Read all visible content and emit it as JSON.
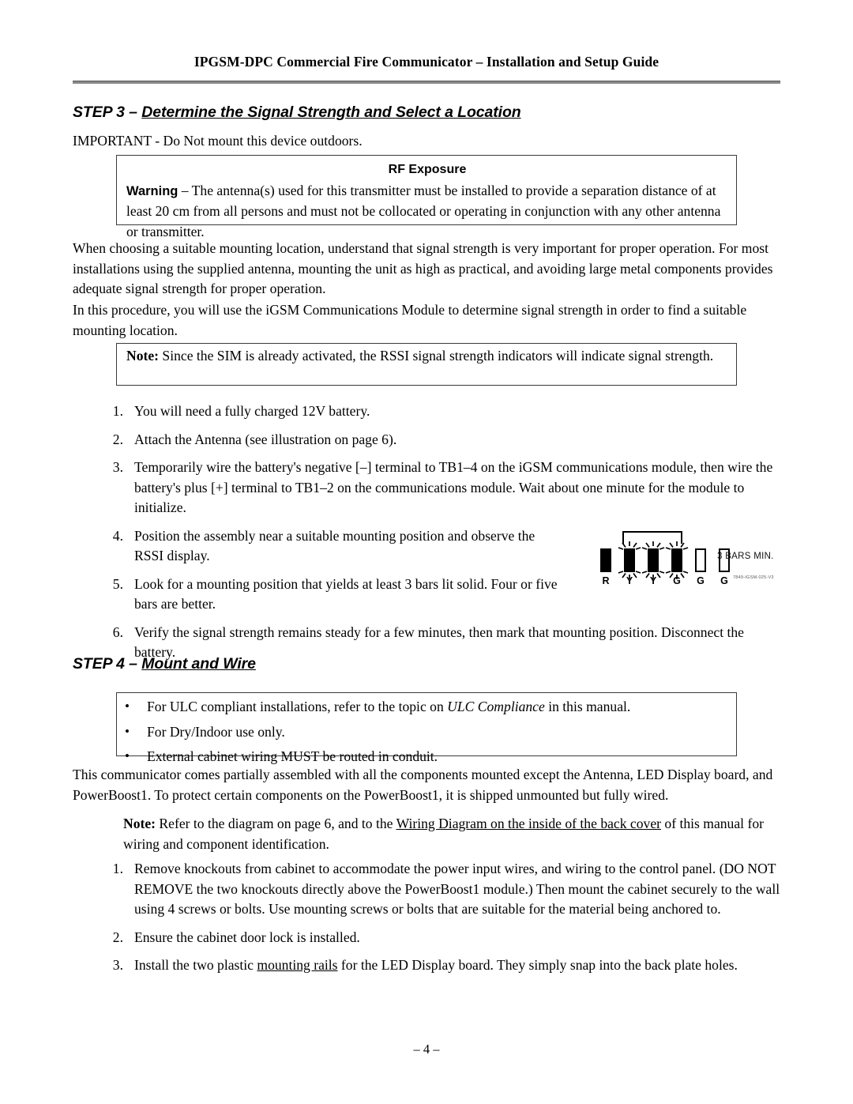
{
  "header": {
    "title": "IPGSM-DPC Commercial Fire Communicator – Installation and Setup Guide"
  },
  "step3": {
    "label": "STEP 3 – ",
    "title": "Determine the Signal Strength and Select a Location",
    "important": "IMPORTANT - Do Not mount this device outdoors.",
    "rf_box": {
      "title": "RF Exposure",
      "lead": "Warning",
      "body": " – The antenna(s) used for this transmitter must be installed to provide a separation distance of at least 20 cm from all persons and must not be collocated or operating in conjunction with any other antenna or transmitter."
    },
    "para1": "When choosing a suitable mounting location, understand that signal strength is very important for proper operation.  For most installations using the supplied antenna, mounting the unit as high as practical, and avoiding large metal components provides adequate signal strength for proper operation.",
    "para2": "In this procedure, you will use the iGSM Communications Module to determine signal strength in order to find a suitable mounting location.",
    "note_box": {
      "lead": "Note:",
      "body": " Since the SIM is already activated, the RSSI signal strength indicators will indicate signal strength."
    },
    "steps": [
      {
        "num": "1.",
        "text": "You will need a fully charged 12V battery."
      },
      {
        "num": "2.",
        "text": "Attach the Antenna (see illustration on page 6)."
      },
      {
        "num": "3.",
        "text": "Temporarily wire the battery's negative [–] terminal to TB1–4 on the iGSM communications module, then wire the battery's plus [+] terminal to TB1–2 on the communications module.  Wait about one minute for the module to initialize."
      },
      {
        "num": "4.",
        "text": "Position the assembly near a suitable mounting position and observe the RSSI display."
      },
      {
        "num": "5.",
        "text": "Look for a mounting position that yields at least 3 bars lit solid.  Four or five bars are better."
      },
      {
        "num": "6.",
        "text": "Verify the signal strength remains steady for a few minutes, then mark that mounting position.  Disconnect the battery."
      }
    ]
  },
  "rssi_figure": {
    "leds": [
      {
        "label": "R",
        "state": "on",
        "flashing": false
      },
      {
        "label": "Y",
        "state": "on",
        "flashing": true
      },
      {
        "label": "Y",
        "state": "on",
        "flashing": true
      },
      {
        "label": "G",
        "state": "on",
        "flashing": true
      },
      {
        "label": "G",
        "state": "off",
        "flashing": false
      },
      {
        "label": "G",
        "state": "off",
        "flashing": false
      }
    ],
    "caption": "3 BARS MIN.",
    "part_number": "7849-IGSM-025-V3"
  },
  "step4": {
    "label": "STEP 4 – ",
    "title": "Mount and Wire",
    "bullets": [
      {
        "pre": "For ULC compliant installations, refer to the topic on ",
        "italic": "ULC Compliance",
        "post": " in this manual."
      },
      {
        "pre": "For Dry/Indoor use only.",
        "italic": "",
        "post": ""
      },
      {
        "pre": "External cabinet wiring MUST be routed in conduit.",
        "italic": "",
        "post": ""
      }
    ],
    "bullet_glyph": "•",
    "para1": "This communicator comes partially assembled with all the components mounted except the Antenna, LED Display board, and PowerBoost1.  To protect certain components on the PowerBoost1, it is shipped unmounted but fully wired.",
    "note": {
      "lead": "Note:",
      "pre": " Refer to the diagram on page 6, and to the ",
      "underline": "Wiring Diagram on the inside of the back cover",
      "post": " of this manual for wiring and component identification."
    },
    "steps": [
      {
        "num": "1.",
        "pre": "Remove knockouts from cabinet to accommodate the power input wires, and wiring to the control panel.  (DO NOT REMOVE the two knockouts directly above the PowerBoost1 module.)  Then mount the cabinet securely to the wall using 4 screws or bolts.  Use mounting screws or bolts that are suitable for the material being anchored to.",
        "underline": "",
        "post": ""
      },
      {
        "num": "2.",
        "pre": "Ensure the cabinet door lock is installed.",
        "underline": "",
        "post": ""
      },
      {
        "num": "3.",
        "pre": "Install the two plastic ",
        "underline": "mounting rails",
        "post": " for the LED Display board.  They simply snap into the back plate holes."
      }
    ]
  },
  "footer": {
    "page_number": "– 4 –"
  }
}
